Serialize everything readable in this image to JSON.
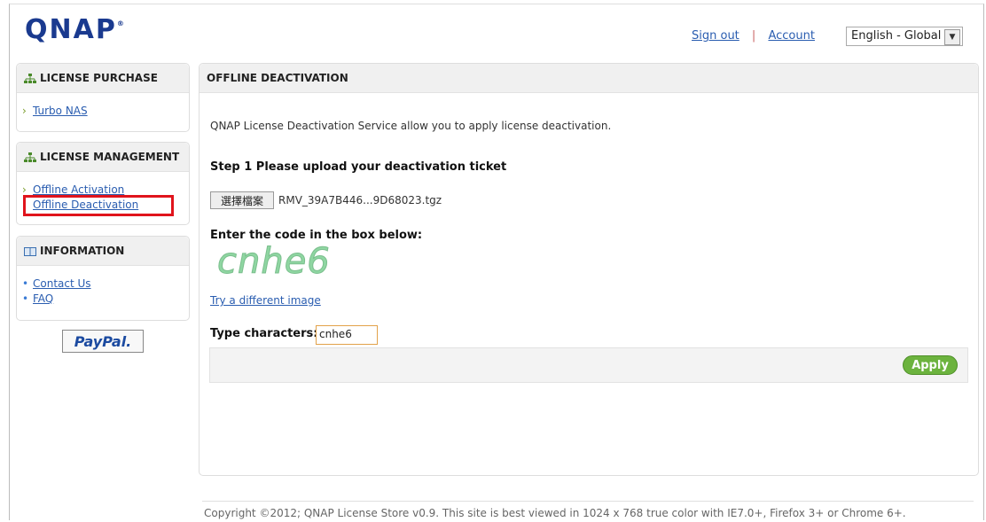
{
  "header": {
    "logo": "QNAP",
    "logo_mark": "®",
    "sign_out": "Sign out",
    "separator": "|",
    "account": "Account",
    "language": "English - Global"
  },
  "sidebar": {
    "purchase": {
      "title": "LICENSE PURCHASE",
      "items": [
        "Turbo NAS"
      ]
    },
    "management": {
      "title": "LICENSE MANAGEMENT",
      "items": [
        "Offline Activation",
        "Offline Deactivation"
      ]
    },
    "information": {
      "title": "INFORMATION",
      "items": [
        "Contact Us",
        "FAQ"
      ]
    },
    "paypal": "PayPal."
  },
  "main": {
    "title": "OFFLINE DEACTIVATION",
    "intro": "QNAP License Deactivation Service allow you to apply license deactivation.",
    "step1": "Step 1 Please upload your deactivation ticket",
    "file_button": "選擇檔案",
    "file_name": "RMV_39A7B446...9D68023.tgz",
    "code_prompt": "Enter the code in the box below:",
    "captcha_text": "cnhe6",
    "try_link": "Try a different image",
    "type_label": "Type characters:",
    "type_value": "cnhe6",
    "apply": "Apply"
  },
  "footer": {
    "copyright": "Copyright ©2012; QNAP License Store v0.9. This site is best viewed in 1024 x 768 true color with IE7.0+, Firefox 3+ or Chrome 6+."
  },
  "colors": {
    "highlight": "#e0141c",
    "apply_button": "#6cb33e",
    "link": "#2a5db0",
    "logo": "#1a3a8f"
  },
  "icons": [
    "sitemap-icon",
    "sitemap-icon",
    "book-icon",
    "chevron-down-icon"
  ]
}
